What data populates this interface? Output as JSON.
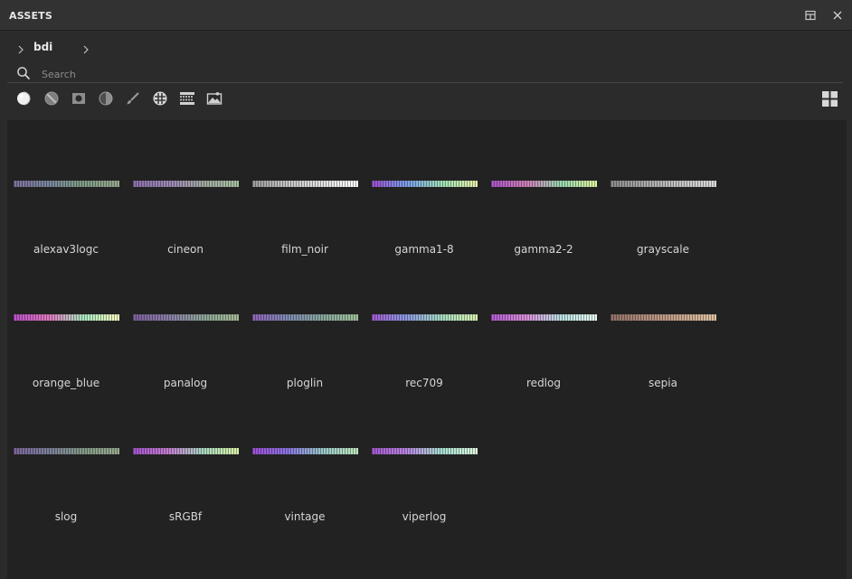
{
  "panel": {
    "title": "ASSETS",
    "maximize_icon": "panel-maximize-icon",
    "close_icon": "close-icon"
  },
  "breadcrumb": {
    "path": "bdi"
  },
  "search": {
    "placeholder": "Search",
    "value": ""
  },
  "filters": [
    {
      "icon": "material-sphere-icon",
      "active": true
    },
    {
      "icon": "smart-material-icon",
      "active": false
    },
    {
      "icon": "mask-icon",
      "active": false
    },
    {
      "icon": "filter-icon",
      "active": false
    },
    {
      "icon": "brush-icon",
      "active": false
    },
    {
      "icon": "texture-icon",
      "active": false
    },
    {
      "icon": "lut-icon",
      "active": false
    },
    {
      "icon": "environment-icon",
      "active": false
    }
  ],
  "view_toggle": "grid-view-icon",
  "colors": {
    "background": "#2b2b2b",
    "grid_background": "#222222",
    "text": "#d6d6d6"
  },
  "assets": [
    {
      "name": "alexav3logc",
      "gradient": "linear-gradient(90deg,#7d6f9c,#78869c,#7f9a86,#9aa88f)"
    },
    {
      "name": "cineon",
      "gradient": "linear-gradient(90deg,#8a6fa8,#9a86b4,#a0a8a2,#a6bfa0)"
    },
    {
      "name": "film_noir",
      "gradient": "linear-gradient(90deg,#9a9a9a,#c4c4c4,#e2e2e2,#ffffff)"
    },
    {
      "name": "gamma1-8",
      "gradient": "linear-gradient(90deg,#9b4fd0,#7aa0e8,#9fe0b8,#e8f0a8)"
    },
    {
      "name": "gamma2-2",
      "gradient": "linear-gradient(90deg,#a855c8,#d080b8,#98d8b0,#e0f4a0)"
    },
    {
      "name": "grayscale",
      "gradient": "linear-gradient(90deg,#8a8a8a,#a8a8a8,#c4c4c4,#dadada)"
    },
    {
      "name": "orange_blue",
      "gradient": "linear-gradient(90deg,#b84fc8,#e07ac0,#a8e8c0,#f8f8c0)"
    },
    {
      "name": "panalog",
      "gradient": "linear-gradient(90deg,#7a5f9a,#8a7ca8,#8ca596,#a4b894)"
    },
    {
      "name": "ploglin",
      "gradient": "linear-gradient(90deg,#8f62b8,#7e8ab0,#88a69c,#9ec09a)"
    },
    {
      "name": "rec709",
      "gradient": "linear-gradient(90deg,#a05cd0,#8c9ae0,#a6dcc0,#d8f0b0)"
    },
    {
      "name": "redlog",
      "gradient": "linear-gradient(90deg,#b05ad0,#d890d8,#b8e0e0,#e8f8f0)"
    },
    {
      "name": "sepia",
      "gradient": "linear-gradient(90deg,#8f6f68,#b08c7c,#c8a68e,#dcc0a0)"
    },
    {
      "name": "slog",
      "gradient": "linear-gradient(90deg,#7a6498,#7c7e9a,#839a88,#98aa8c)"
    },
    {
      "name": "sRGBf",
      "gradient": "linear-gradient(90deg,#a255cc,#c47cd0,#a8d8c0,#dcf4a8)"
    },
    {
      "name": "vintage",
      "gradient": "linear-gradient(90deg,#9c4fd4,#8a74e0,#98c8c8,#c0e8c0)"
    },
    {
      "name": "viperlog",
      "gradient": "linear-gradient(90deg,#a258d0,#b886e0,#a8e0d0,#e0f8e0)"
    }
  ]
}
